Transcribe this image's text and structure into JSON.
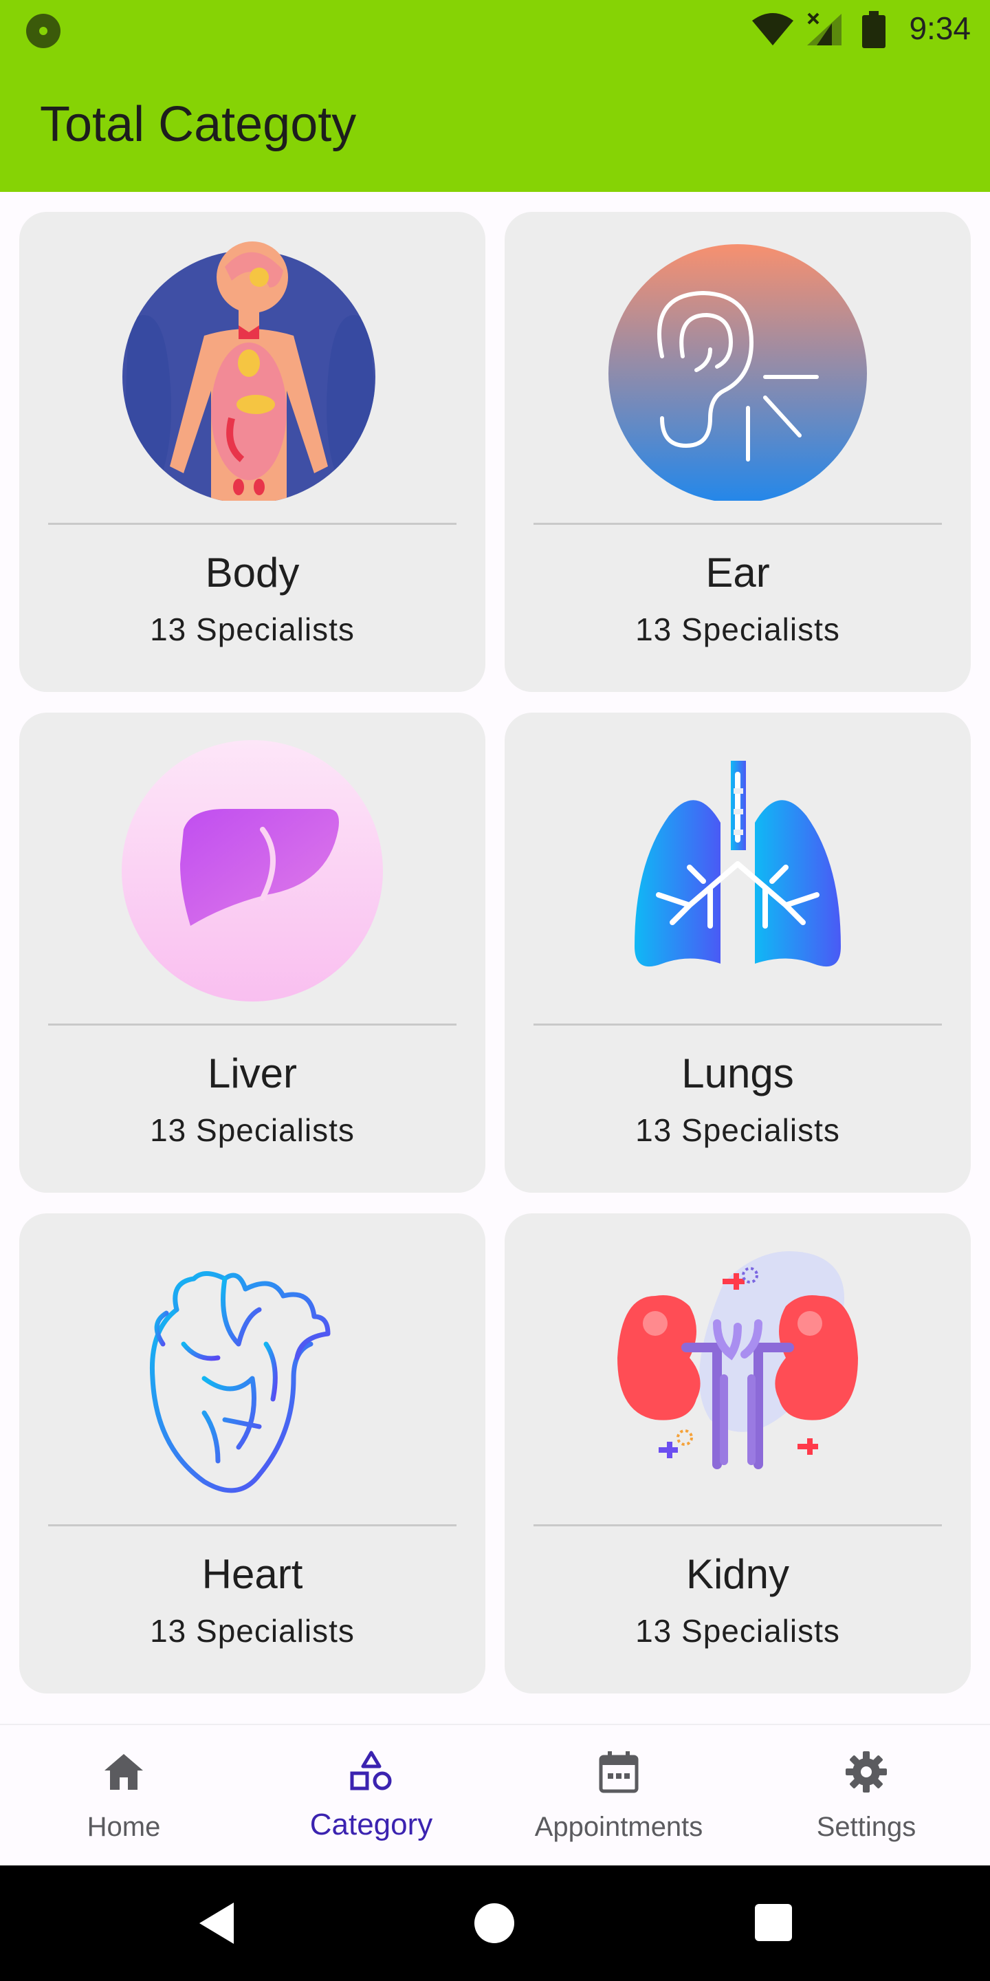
{
  "status_bar": {
    "time": "9:34"
  },
  "app_bar": {
    "title": "Total Categoty"
  },
  "categories": [
    {
      "name": "Body",
      "specialists": "13 Specialists",
      "icon": "human-body-icon"
    },
    {
      "name": "Ear",
      "specialists": "13 Specialists",
      "icon": "ear-icon"
    },
    {
      "name": "Liver",
      "specialists": "13 Specialists",
      "icon": "liver-icon"
    },
    {
      "name": "Lungs",
      "specialists": "13 Specialists",
      "icon": "lungs-icon"
    },
    {
      "name": "Heart",
      "specialists": "13 Specialists",
      "icon": "heart-icon"
    },
    {
      "name": "Kidny",
      "specialists": "13 Specialists",
      "icon": "kidney-icon"
    }
  ],
  "bottom_nav": {
    "active": "Category",
    "items": [
      {
        "label": "Home",
        "icon": "home-icon"
      },
      {
        "label": "Category",
        "icon": "category-icon"
      },
      {
        "label": "Appointments",
        "icon": "calendar-icon"
      },
      {
        "label": "Settings",
        "icon": "gear-icon"
      }
    ]
  },
  "colors": {
    "app_bar": "#86d305",
    "card_bg": "#ededed",
    "nav_active": "#3b23b0",
    "nav_inactive": "#5b5b5f"
  }
}
